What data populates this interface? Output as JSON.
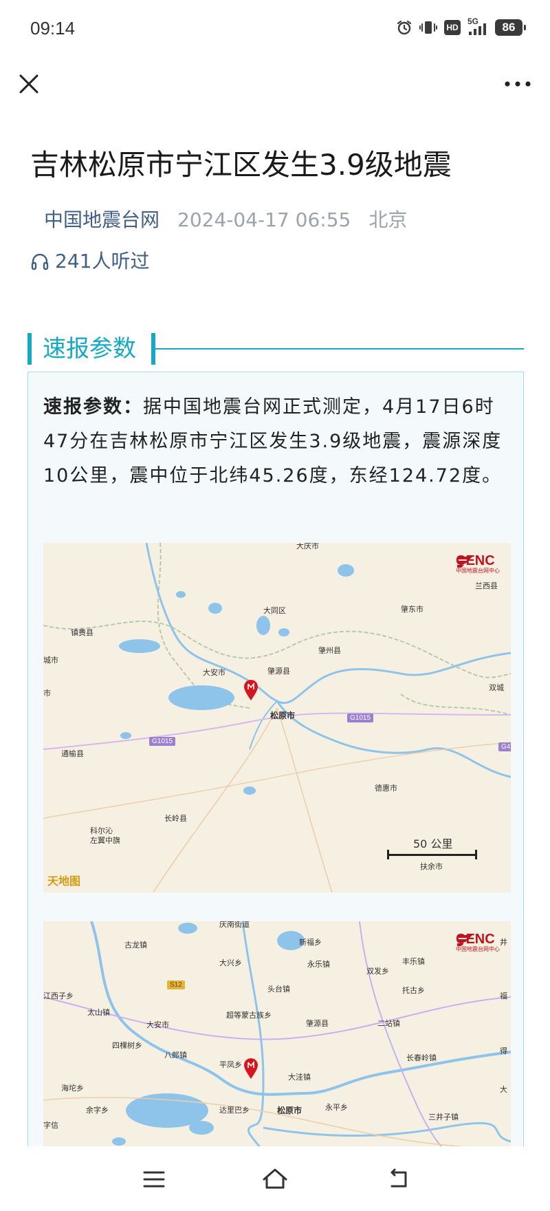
{
  "status": {
    "time": "09:14",
    "hd_label": "HD",
    "network_label": "5G",
    "battery": "86",
    "icons": [
      "alarm-icon",
      "vibrate-icon",
      "hd-icon",
      "signal-icon",
      "battery-icon"
    ]
  },
  "topbar": {
    "close_icon": "close-icon",
    "more_icon": "more-icon"
  },
  "article": {
    "title": "吉林松原市宁江区发生3.9级地震",
    "source": "中国地震台网",
    "datetime": "2024-04-17 06:55",
    "location": "北京",
    "listen_count": "241人听过"
  },
  "section": {
    "heading": "速报参数",
    "label": "速报参数：",
    "body": "据中国地震台网正式测定，4月17日6时47分在吉林松原市宁江区发生3.9级地震，震源深度10公里，震中位于北纬45.26度，东经124.72度。"
  },
  "map1": {
    "logo": "CENC",
    "logo_sub": "中国地震台网中心",
    "scale": "50 公里",
    "attribution": "天地图",
    "labels": {
      "daqing": "大庆市",
      "lanxi": "兰西县",
      "zhaodong": "肇东市",
      "datong": "大同区",
      "zhenlai": "镇赉县",
      "cheng": "城市",
      "zhaozhou": "肇州县",
      "zhaoyuan": "肇源县",
      "daan": "大安市",
      "shuangcheng": "双城",
      "shi": "市",
      "songyuan": "松原市",
      "tongyu": "通榆县",
      "dehui": "德惠市",
      "changling": "长岭县",
      "keerqin": "科尔沁",
      "zuoyi": "左翼中旗",
      "fuyu": "扶余市"
    },
    "roads": {
      "g1015_a": "G1015",
      "g1015_b": "G1015",
      "g_edge": "G4"
    }
  },
  "map2": {
    "logo": "CENC",
    "logo_sub": "中国地震台网中心",
    "labels": {
      "qinan": "庆南街道",
      "gulong": "古龙镇",
      "daxing": "大兴乡",
      "xinfu": "新福乡",
      "yongle": "永乐镇",
      "fengle": "丰乐镇",
      "shuangfa": "双发乡",
      "jing": "井",
      "toutai": "头台镇",
      "tuogu": "托古乡",
      "jiangxi": "江西子乡",
      "fu": "福",
      "taishan": "太山镇",
      "chaodeng": "超等蒙古族乡",
      "daan": "大安市",
      "zhaoyuan": "肇源县",
      "erzhan": "二站镇",
      "sikeshu": "四棵树乡",
      "balang": "八郎镇",
      "pingfeng": "平凤乡",
      "changchunling": "长春岭镇",
      "de": "得",
      "haituo": "海坨乡",
      "dawa": "大洼镇",
      "da": "大",
      "yuzi": "余字乡",
      "daliba": "达里巴乡",
      "songyuan": "松原市",
      "yongping": "永平乡",
      "sanjingzi": "三井子镇",
      "zixin": "字信"
    },
    "roads": {
      "s12": "S12"
    }
  },
  "navbar": {
    "icons": [
      "menu-icon",
      "home-icon",
      "back-icon"
    ]
  },
  "colors": {
    "accent": "#17a9c4",
    "source_link": "#3f5f86",
    "meta_gray": "#9aa3ad",
    "card_bg": "#f4fafc",
    "pin": "#d5161e",
    "cenc_red": "#c1121f"
  }
}
